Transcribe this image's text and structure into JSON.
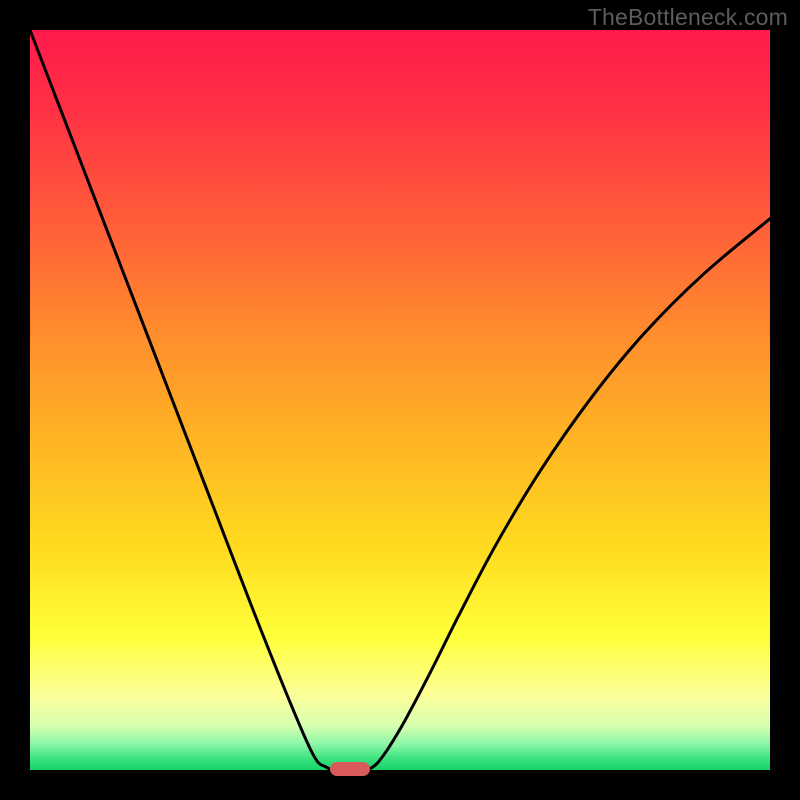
{
  "watermark": "TheBottleneck.com",
  "colors": {
    "gradient_stops": [
      {
        "offset": 0.0,
        "color": "#ff1a4b"
      },
      {
        "offset": 0.1,
        "color": "#ff2f45"
      },
      {
        "offset": 0.25,
        "color": "#ff5a3a"
      },
      {
        "offset": 0.4,
        "color": "#ff8a2e"
      },
      {
        "offset": 0.55,
        "color": "#ffb324"
      },
      {
        "offset": 0.7,
        "color": "#ffdb1f"
      },
      {
        "offset": 0.82,
        "color": "#ffff3a"
      },
      {
        "offset": 0.9,
        "color": "#fbff9a"
      },
      {
        "offset": 0.94,
        "color": "#d8ffb0"
      },
      {
        "offset": 0.965,
        "color": "#8cf7a8"
      },
      {
        "offset": 0.985,
        "color": "#39e27e"
      },
      {
        "offset": 1.0,
        "color": "#18d468"
      }
    ],
    "curve_stroke": "#000000",
    "marker_fill": "#d85a5a",
    "frame_bg": "#000000",
    "watermark_text": "#5c5c5c"
  },
  "chart_data": {
    "type": "line",
    "title": "",
    "xlabel": "",
    "ylabel": "",
    "xlim": [
      0,
      1
    ],
    "ylim": [
      0,
      1
    ],
    "series": [
      {
        "name": "left-curve",
        "x": [
          0.0,
          0.05,
          0.1,
          0.15,
          0.2,
          0.25,
          0.3,
          0.35,
          0.383,
          0.4,
          0.412
        ],
        "values": [
          1.0,
          0.87,
          0.74,
          0.61,
          0.48,
          0.35,
          0.22,
          0.095,
          0.02,
          0.004,
          0.0
        ]
      },
      {
        "name": "right-curve",
        "x": [
          0.452,
          0.47,
          0.5,
          0.54,
          0.58,
          0.63,
          0.69,
          0.76,
          0.83,
          0.91,
          1.0
        ],
        "values": [
          0.0,
          0.01,
          0.055,
          0.13,
          0.21,
          0.305,
          0.405,
          0.505,
          0.59,
          0.67,
          0.745
        ]
      }
    ],
    "marker": {
      "x_start": 0.405,
      "x_end": 0.46,
      "y": 0.0
    },
    "grid": false,
    "legend": false
  }
}
